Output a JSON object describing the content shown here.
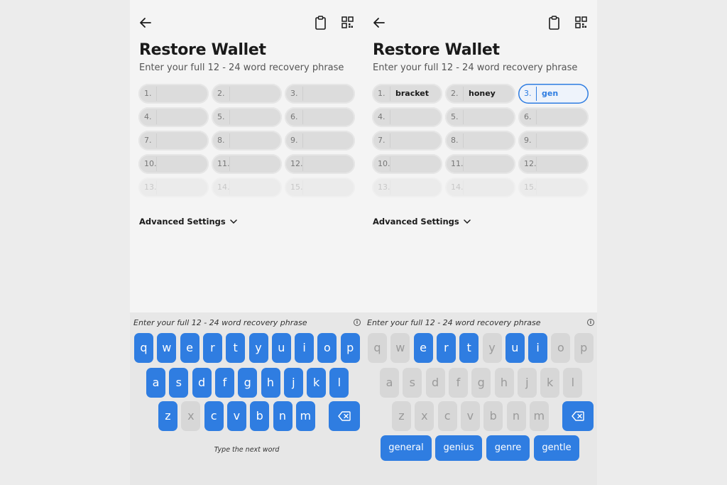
{
  "screens": [
    {
      "title": "Restore Wallet",
      "subtitle": "Enter your full 12 - 24 word recovery phrase",
      "words": [
        "1.",
        "2.",
        "3.",
        "4.",
        "5.",
        "6.",
        "7.",
        "8.",
        "9.",
        "10.",
        "11.",
        "12.",
        "13.",
        "14.",
        "15."
      ],
      "entries": [
        "",
        "",
        "",
        "",
        "",
        "",
        "",
        "",
        "",
        "",
        "",
        "",
        "",
        "",
        ""
      ],
      "advanced": "Advanced Settings",
      "kbd_hint": "Enter your full 12 - 24 word recovery phrase",
      "info_icon": "i",
      "rows": [
        [
          "q",
          "w",
          "e",
          "r",
          "t",
          "y",
          "u",
          "i",
          "o",
          "p"
        ],
        [
          "a",
          "s",
          "d",
          "f",
          "g",
          "h",
          "j",
          "k",
          "l"
        ],
        [
          "z",
          "x",
          "c",
          "v",
          "b",
          "n",
          "m"
        ]
      ],
      "disabled": [
        "x"
      ],
      "footer": "Type the next word",
      "suggestions": []
    },
    {
      "title": "Restore Wallet",
      "subtitle": "Enter your full 12 - 24 word recovery phrase",
      "words": [
        "1.",
        "2.",
        "3.",
        "4.",
        "5.",
        "6.",
        "7.",
        "8.",
        "9.",
        "10.",
        "11.",
        "12.",
        "13.",
        "14.",
        "15."
      ],
      "entries": [
        "bracket",
        "honey",
        "gen",
        "",
        "",
        "",
        "",
        "",
        "",
        "",
        "",
        "",
        "",
        "",
        ""
      ],
      "active_index": 2,
      "advanced": "Advanced Settings",
      "kbd_hint": "Enter your full 12 - 24 word recovery phrase",
      "info_icon": "i",
      "rows": [
        [
          "q",
          "w",
          "e",
          "r",
          "t",
          "y",
          "u",
          "i",
          "o",
          "p"
        ],
        [
          "a",
          "s",
          "d",
          "f",
          "g",
          "h",
          "j",
          "k",
          "l"
        ],
        [
          "z",
          "x",
          "c",
          "v",
          "b",
          "n",
          "m"
        ]
      ],
      "enabled": [
        "e",
        "r",
        "t",
        "u",
        "i"
      ],
      "footer": "",
      "suggestions": [
        "general",
        "genius",
        "genre",
        "gentle"
      ]
    }
  ],
  "colors": {
    "accent": "#2f7de1",
    "key_disabled": "#d7d7d7",
    "cell_bg": "#dcdcdc"
  },
  "icons": [
    "back-arrow-icon",
    "clipboard-icon",
    "qr-code-icon",
    "chevron-down-icon",
    "info-icon",
    "backspace-icon"
  ]
}
